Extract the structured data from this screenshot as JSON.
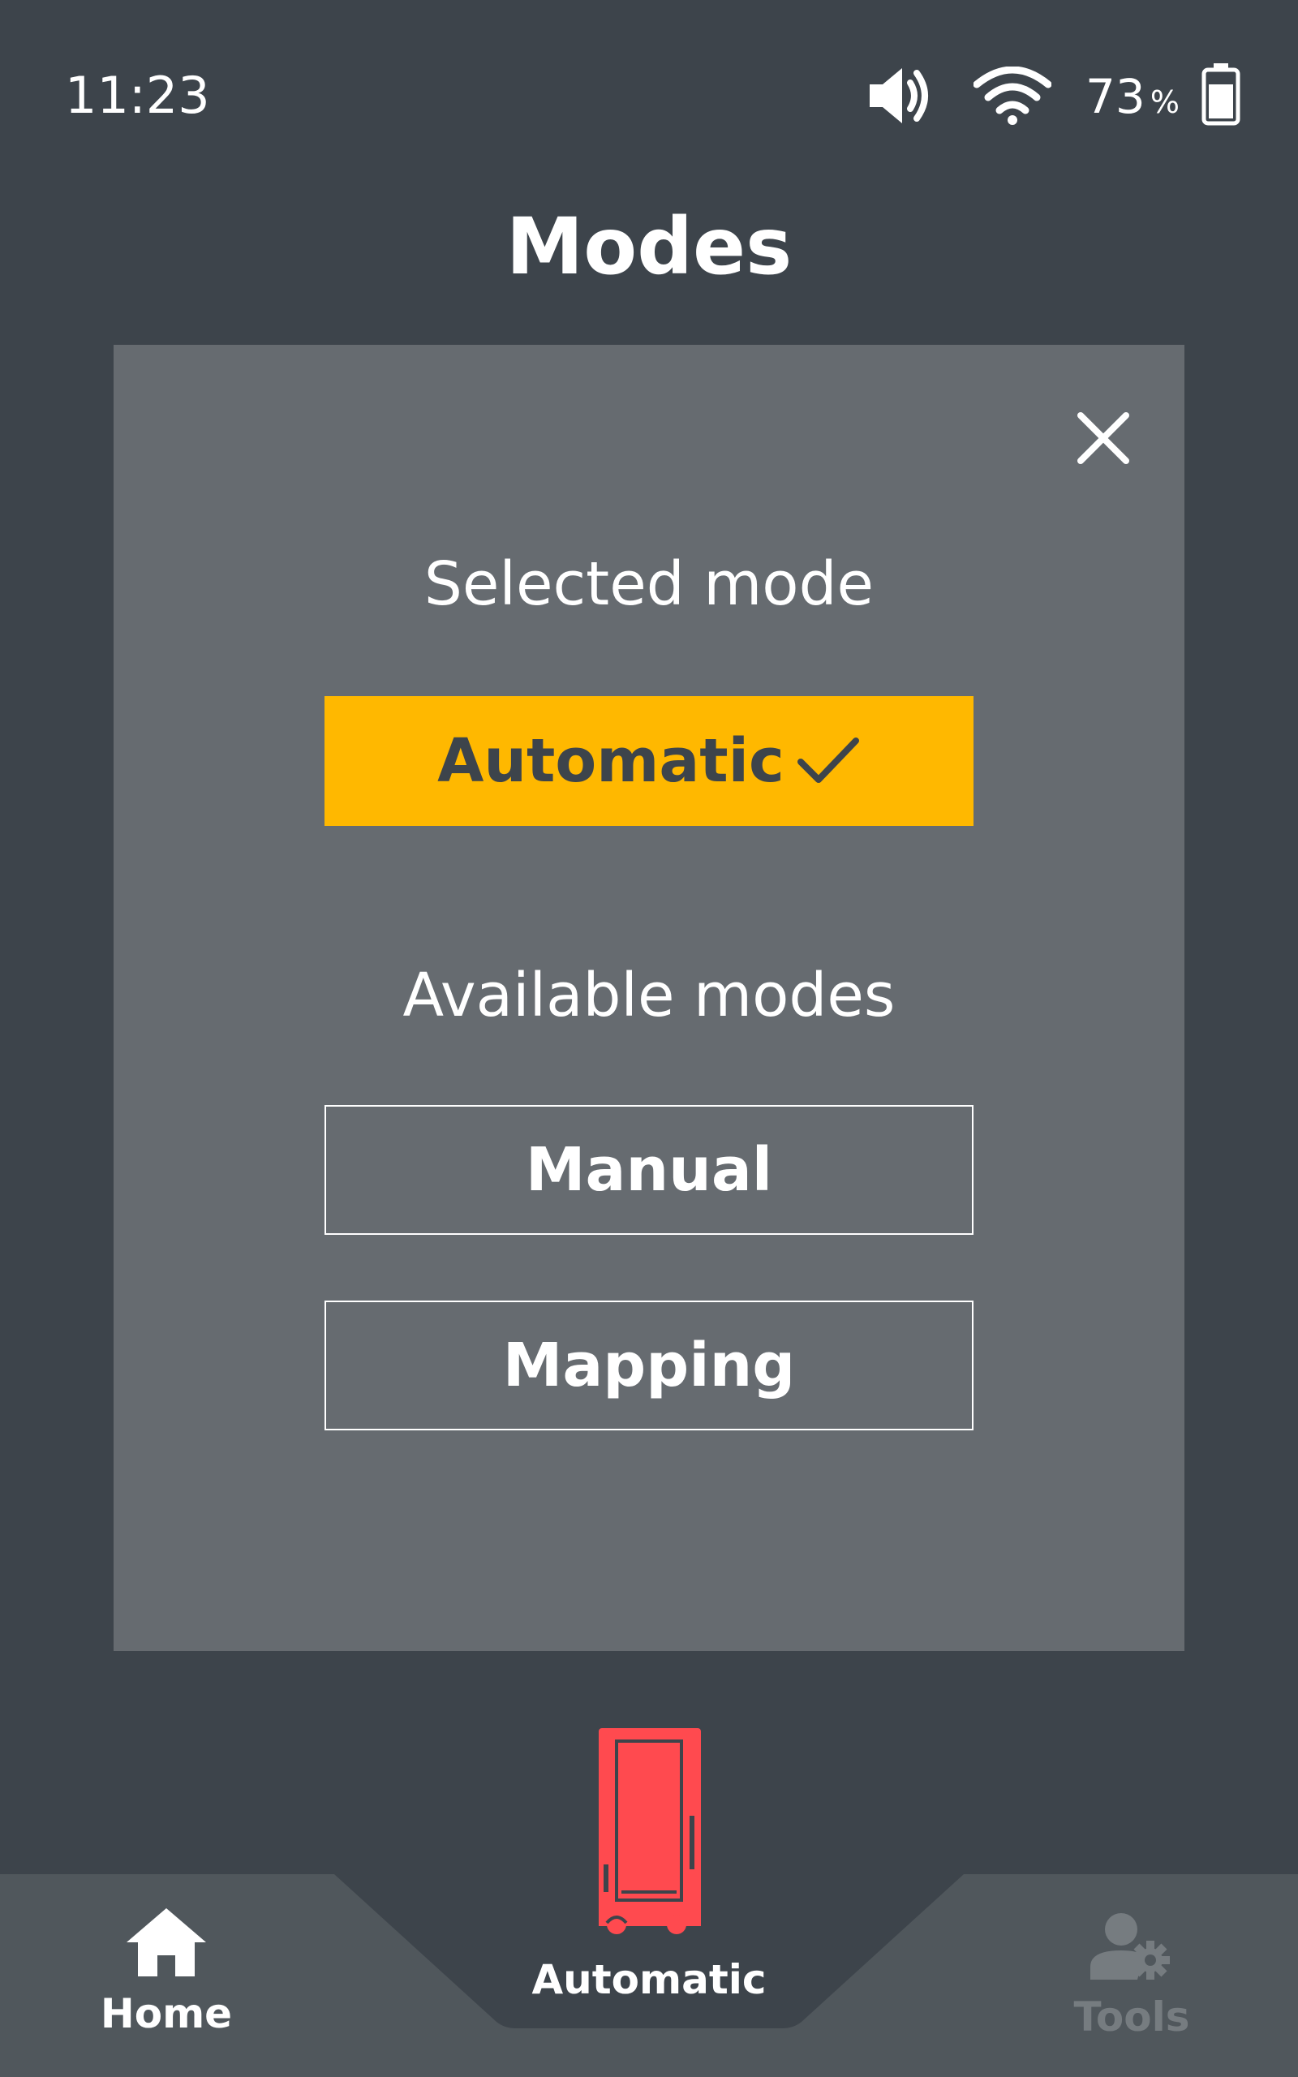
{
  "status_bar": {
    "time": "11:23",
    "battery_value": "73",
    "battery_unit": "%",
    "icons": [
      "volume-icon",
      "wifi-icon",
      "battery-icon"
    ]
  },
  "page": {
    "title": "Modes"
  },
  "dialog": {
    "close_icon": "close-icon",
    "selected_heading": "Selected mode",
    "selected_mode": "Automatic",
    "selected_icon": "check-icon",
    "available_heading": "Available modes",
    "available_modes": [
      "Manual",
      "Mapping"
    ]
  },
  "bottom_nav": {
    "home_label": "Home",
    "home_icon": "home-icon",
    "center_label": "Automatic",
    "center_icon": "robot-vehicle-icon",
    "tools_label": "Tools",
    "tools_icon": "user-settings-icon"
  },
  "colors": {
    "background": "#3d444b",
    "dialog": "#666b70",
    "accent": "#ffb800",
    "robot": "#ff4a4f",
    "nav_bar": "#50575c",
    "disabled": "#767c80"
  }
}
